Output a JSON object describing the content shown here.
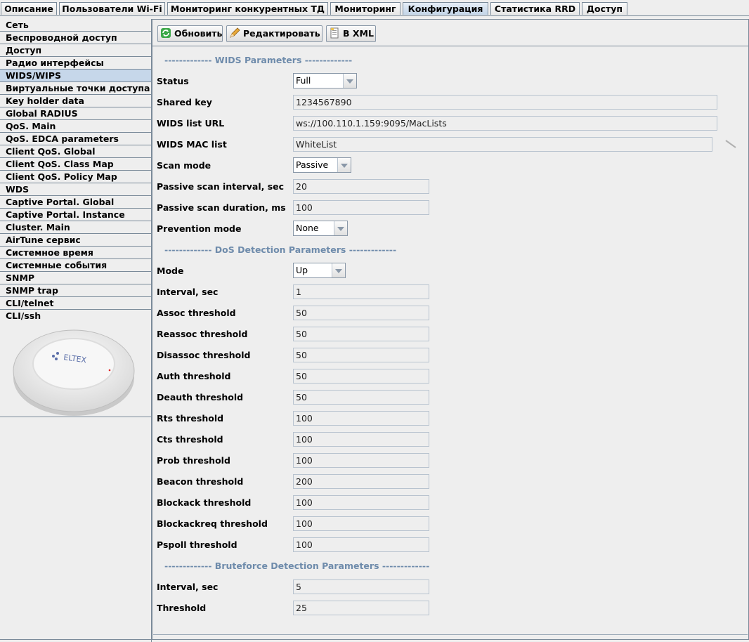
{
  "tabs": [
    {
      "label": "Описание",
      "active": false
    },
    {
      "label": "Пользователи Wi-Fi",
      "active": false
    },
    {
      "label": "Мониторинг конкурентных ТД",
      "active": false
    },
    {
      "label": "Мониторинг",
      "active": false
    },
    {
      "label": "Конфигурация",
      "active": true
    },
    {
      "label": "Статистика RRD",
      "active": false
    },
    {
      "label": "Доступ",
      "active": false
    }
  ],
  "sidebar": {
    "items": [
      "Сеть",
      "Беспроводной доступ",
      "Доступ",
      "Радио интерфейсы",
      "WIDS/WIPS",
      "Виртуальные точки доступа",
      "Key holder data",
      "Global RADIUS",
      "QoS. Main",
      "QoS. EDCA parameters",
      "Client QoS. Global",
      "Client QoS. Class Map",
      "Client QoS. Policy Map",
      "WDS",
      "Captive Portal. Global",
      "Captive Portal. Instance",
      "Cluster. Main",
      "AirTune сервис",
      "Системное время",
      "Системные события",
      "SNMP",
      "SNMP trap",
      "CLI/telnet",
      "CLI/ssh"
    ],
    "selected_index": 4,
    "device_logo": "ELTEX"
  },
  "toolbar": {
    "refresh_label": "Обновить",
    "refresh_icon": "refresh-icon",
    "edit_label": "Редактировать",
    "edit_icon": "pencil-icon",
    "xml_label": "В XML",
    "xml_icon": "document-icon"
  },
  "sections": {
    "wids": "------------- WIDS Parameters -------------",
    "dos": "------------- DoS Detection Parameters -------------",
    "bruteforce": "------------- Bruteforce Detection Parameters -------------"
  },
  "wids": {
    "status_label": "Status",
    "status_value": "Full",
    "shared_key_label": "Shared key",
    "shared_key_value": "1234567890",
    "url_label": "WIDS list URL",
    "url_value": "ws://100.110.1.159:9095/MacLists",
    "mac_list_label": "WIDS MAC list",
    "mac_list_value": "WhiteList",
    "scan_mode_label": "Scan mode",
    "scan_mode_value": "Passive",
    "scan_interval_label": "Passive scan interval, sec",
    "scan_interval_value": "20",
    "scan_duration_label": "Passive scan duration, ms",
    "scan_duration_value": "100",
    "prevention_label": "Prevention mode",
    "prevention_value": "None"
  },
  "dos": {
    "mode_label": "Mode",
    "mode_value": "Up",
    "interval_label": "Interval, sec",
    "interval_value": "1",
    "assoc_label": "Assoc threshold",
    "assoc_value": "50",
    "reassoc_label": "Reassoc threshold",
    "reassoc_value": "50",
    "disassoc_label": "Disassoc threshold",
    "disassoc_value": "50",
    "auth_label": "Auth threshold",
    "auth_value": "50",
    "deauth_label": "Deauth threshold",
    "deauth_value": "50",
    "rts_label": "Rts threshold",
    "rts_value": "100",
    "cts_label": "Cts threshold",
    "cts_value": "100",
    "prob_label": "Prob threshold",
    "prob_value": "100",
    "beacon_label": "Beacon threshold",
    "beacon_value": "200",
    "blockack_label": "Blockack threshold",
    "blockack_value": "100",
    "blockackreq_label": "Blockackreq threshold",
    "blockackreq_value": "100",
    "pspoll_label": "Pspoll threshold",
    "pspoll_value": "100"
  },
  "bruteforce": {
    "interval_label": "Interval, sec",
    "interval_value": "5",
    "threshold_label": "Threshold",
    "threshold_value": "25"
  }
}
